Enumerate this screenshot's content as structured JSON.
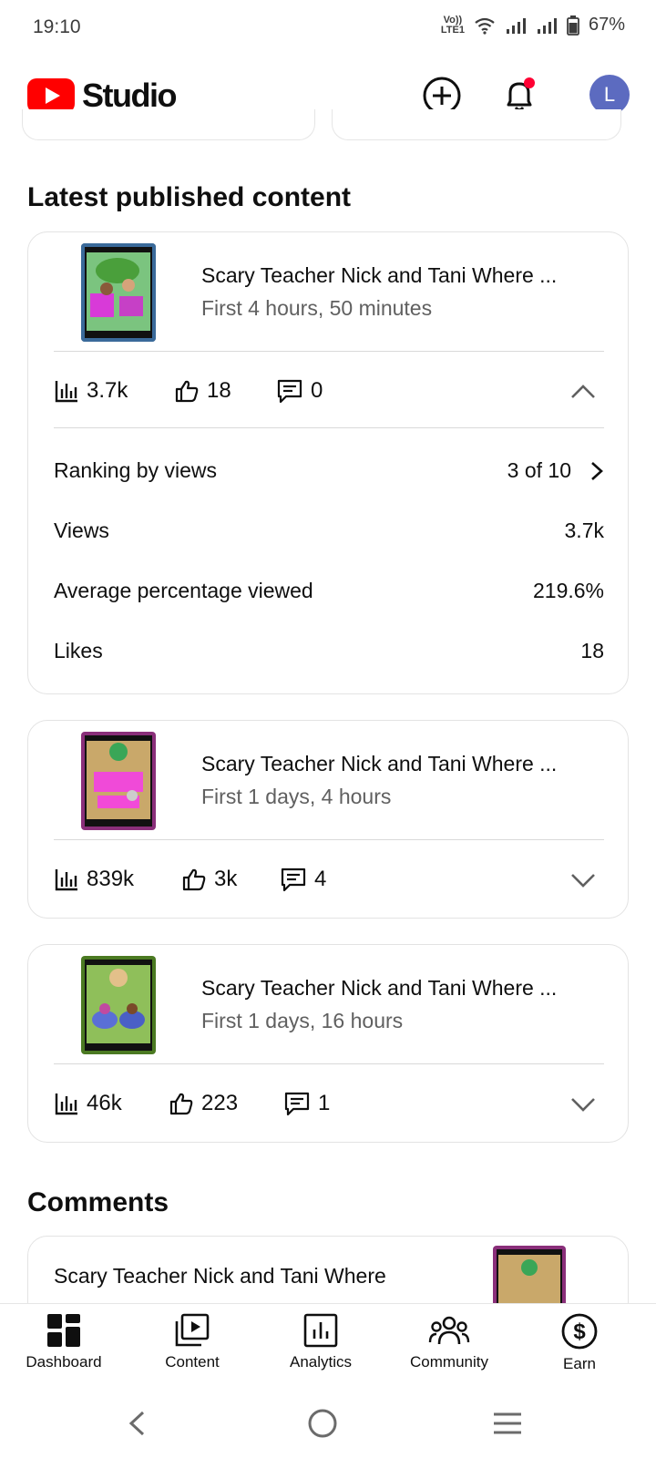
{
  "status_bar": {
    "time": "19:10",
    "network": "VoLTE LTE1",
    "battery": "67%"
  },
  "app": {
    "brand": "Studio",
    "avatar_letter": "L",
    "accent": "#ff0000",
    "notification_dot": "#ff0033",
    "avatar_color": "#5c6bc0"
  },
  "latest": {
    "title": "Latest published content",
    "videos": [
      {
        "title": "Scary Teacher Nick and Tani Where ...",
        "subtitle": "First 4 hours, 50 minutes",
        "views": "3.7k",
        "likes": "18",
        "comments": "0",
        "expanded": true,
        "details": [
          {
            "label": "Ranking by views",
            "value": "3 of 10"
          },
          {
            "label": "Views",
            "value": "3.7k"
          },
          {
            "label": "Average percentage viewed",
            "value": "219.6%"
          },
          {
            "label": "Likes",
            "value": "18"
          }
        ]
      },
      {
        "title": "Scary Teacher Nick and Tani Where ...",
        "subtitle": "First 1 days, 4 hours",
        "views": "839k",
        "likes": "3k",
        "comments": "4",
        "expanded": false
      },
      {
        "title": "Scary Teacher Nick and Tani Where ...",
        "subtitle": "First 1 days, 16 hours",
        "views": "46k",
        "likes": "223",
        "comments": "1",
        "expanded": false
      }
    ]
  },
  "comments": {
    "title": "Comments",
    "preview_text": "Scary Teacher Nick and Tani Where"
  },
  "bottom_nav": [
    {
      "label": "Dashboard",
      "icon": "dashboard-icon"
    },
    {
      "label": "Content",
      "icon": "content-icon"
    },
    {
      "label": "Analytics",
      "icon": "analytics-icon"
    },
    {
      "label": "Community",
      "icon": "community-icon"
    },
    {
      "label": "Earn",
      "icon": "earn-icon"
    }
  ]
}
